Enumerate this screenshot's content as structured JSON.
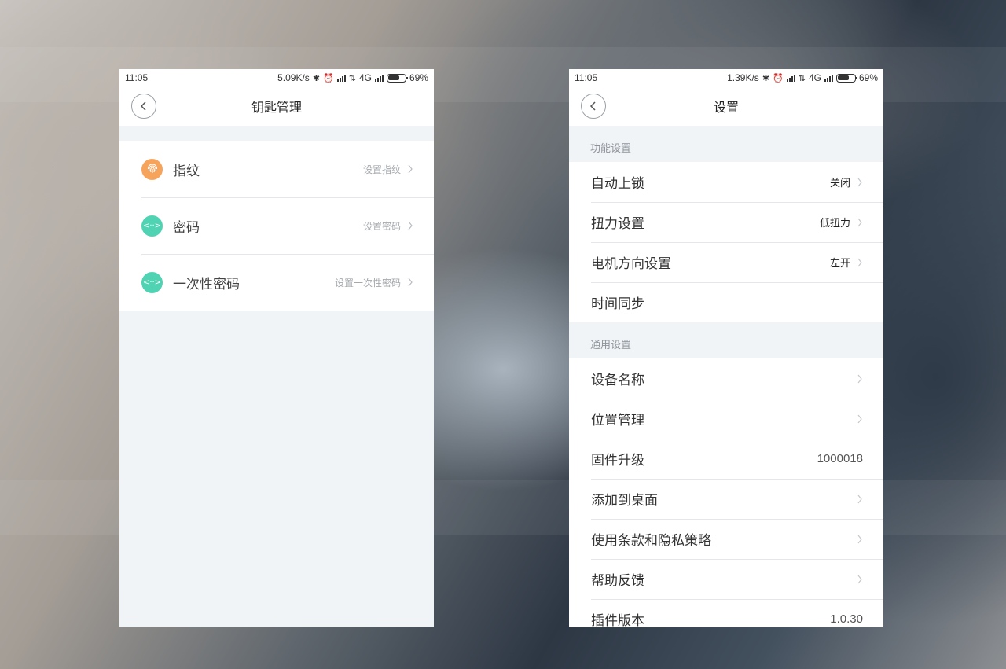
{
  "left": {
    "status": {
      "time": "11:05",
      "speed": "5.09K/s",
      "network": "4G",
      "battery": "69%",
      "battery_level": 0.69
    },
    "title": "钥匙管理",
    "items": [
      {
        "label": "指纹",
        "action": "设置指纹",
        "icon": "fingerprint-icon",
        "color": "#f6a45c"
      },
      {
        "label": "密码",
        "action": "设置密码",
        "icon": "password-icon",
        "color": "#4fd3b3"
      },
      {
        "label": "一次性密码",
        "action": "设置一次性密码",
        "icon": "onetime-password-icon",
        "color": "#4fd3b3"
      }
    ]
  },
  "right": {
    "status": {
      "time": "11:05",
      "speed": "1.39K/s",
      "network": "4G",
      "battery": "69%",
      "battery_level": 0.69
    },
    "title": "设置",
    "sections": [
      {
        "header": "功能设置",
        "items": [
          {
            "label": "自动上锁",
            "value": "关闭",
            "chevron": true
          },
          {
            "label": "扭力设置",
            "value": "低扭力",
            "chevron": true
          },
          {
            "label": "电机方向设置",
            "value": "左开",
            "chevron": true
          },
          {
            "label": "时间同步",
            "value": "",
            "chevron": false
          }
        ]
      },
      {
        "header": "通用设置",
        "items": [
          {
            "label": "设备名称",
            "value": "",
            "chevron": true
          },
          {
            "label": "位置管理",
            "value": "",
            "chevron": true
          },
          {
            "label": "固件升级",
            "value": "1000018",
            "chevron": false
          },
          {
            "label": "添加到桌面",
            "value": "",
            "chevron": true
          },
          {
            "label": "使用条款和隐私策略",
            "value": "",
            "chevron": true
          },
          {
            "label": "帮助反馈",
            "value": "",
            "chevron": true
          },
          {
            "label": "插件版本",
            "value": "1.0.30",
            "chevron": false
          }
        ]
      }
    ]
  }
}
